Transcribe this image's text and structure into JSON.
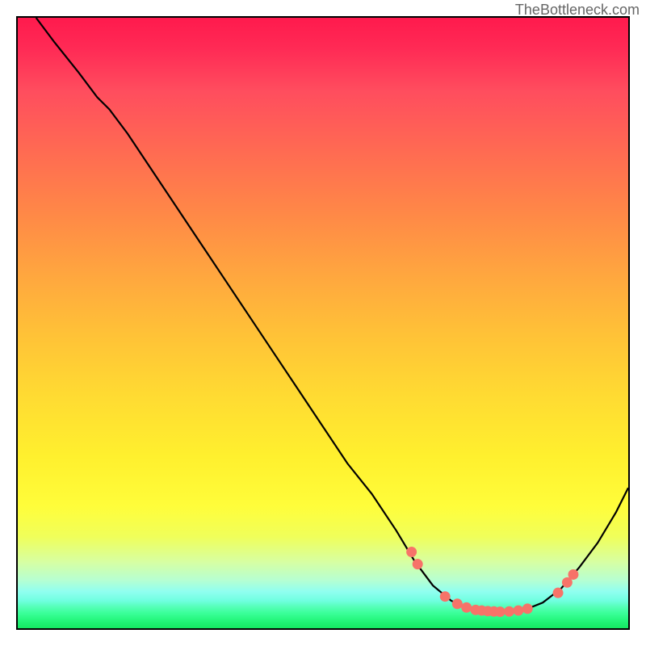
{
  "watermark": "TheBottleneck.com",
  "chart_data": {
    "type": "line",
    "title": "",
    "xlabel": "",
    "ylabel": "",
    "xlim": [
      0,
      100
    ],
    "ylim": [
      0,
      100
    ],
    "curve_points": [
      {
        "x": 3,
        "y": 100
      },
      {
        "x": 6,
        "y": 96
      },
      {
        "x": 10,
        "y": 91
      },
      {
        "x": 13,
        "y": 87
      },
      {
        "x": 15,
        "y": 85
      },
      {
        "x": 18,
        "y": 81
      },
      {
        "x": 22,
        "y": 75
      },
      {
        "x": 26,
        "y": 69
      },
      {
        "x": 30,
        "y": 63
      },
      {
        "x": 34,
        "y": 57
      },
      {
        "x": 38,
        "y": 51
      },
      {
        "x": 42,
        "y": 45
      },
      {
        "x": 46,
        "y": 39
      },
      {
        "x": 50,
        "y": 33
      },
      {
        "x": 54,
        "y": 27
      },
      {
        "x": 58,
        "y": 22
      },
      {
        "x": 62,
        "y": 16
      },
      {
        "x": 65,
        "y": 11
      },
      {
        "x": 68,
        "y": 7
      },
      {
        "x": 71,
        "y": 4.5
      },
      {
        "x": 74,
        "y": 3.2
      },
      {
        "x": 77,
        "y": 2.8
      },
      {
        "x": 80,
        "y": 2.7
      },
      {
        "x": 83,
        "y": 3.0
      },
      {
        "x": 86,
        "y": 4.2
      },
      {
        "x": 89,
        "y": 6.5
      },
      {
        "x": 92,
        "y": 10
      },
      {
        "x": 95,
        "y": 14
      },
      {
        "x": 98,
        "y": 19
      },
      {
        "x": 100,
        "y": 23
      }
    ],
    "marker_points": [
      {
        "x": 64.5,
        "y": 12.5
      },
      {
        "x": 65.5,
        "y": 10.5
      },
      {
        "x": 70,
        "y": 5.2
      },
      {
        "x": 72,
        "y": 4.0
      },
      {
        "x": 73.5,
        "y": 3.4
      },
      {
        "x": 75,
        "y": 3.0
      },
      {
        "x": 76,
        "y": 2.9
      },
      {
        "x": 77,
        "y": 2.8
      },
      {
        "x": 78,
        "y": 2.75
      },
      {
        "x": 79,
        "y": 2.7
      },
      {
        "x": 80.5,
        "y": 2.75
      },
      {
        "x": 82,
        "y": 2.9
      },
      {
        "x": 83.5,
        "y": 3.2
      },
      {
        "x": 88.5,
        "y": 5.8
      },
      {
        "x": 90,
        "y": 7.5
      },
      {
        "x": 91,
        "y": 8.8
      }
    ],
    "colors": {
      "curve": "#000000",
      "markers": "#f77369",
      "gradient_top": "#ff1a4d",
      "gradient_bottom": "#15e862"
    }
  }
}
